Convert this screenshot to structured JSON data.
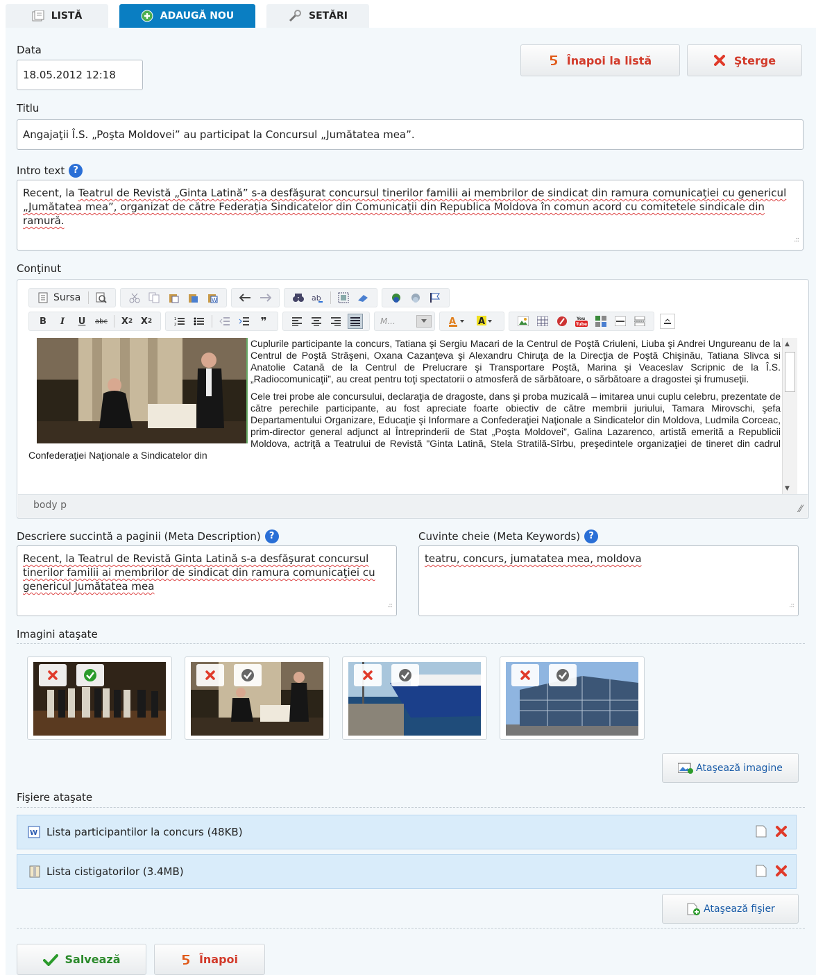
{
  "tabs": [
    {
      "label": "LISTĂ"
    },
    {
      "label": "ADAUGĂ NOU"
    },
    {
      "label": "SETĂRI"
    }
  ],
  "form": {
    "date_label": "Data",
    "date_value": "18.05.2012 12:18",
    "back_to_list": "Înapoi la listă",
    "delete": "Şterge",
    "title_label": "Titlu",
    "title_value": "Angajaţii Î.S. „Poşta Moldovei” au participat la Concursul „Jumătatea mea”.",
    "intro_label": "Intro text",
    "intro_value_1": "Recent,  la ",
    "intro_words": [
      "Teatrul de Revistă „Ginta Latină” s-a desfăşurat  concursul tinerilor familii ai membrilor de sindicat din ramura comunicaţiei cu genericul „Jumătatea mea”, organizat de către Federaţia Sindicatelor din Comunicaţii din Republica Moldova în comun acord cu comitetele sindicale din ramură."
    ],
    "content_label": "Conţinut",
    "meta_description_label": "Descriere succintă a paginii (Meta Description)",
    "meta_description_value": "Recent,  la Teatrul de Revistă Ginta Latină s-a desfăşurat concursul tinerilor familii ai membrilor de sindicat din ramura comunicaţiei cu genericul Jumătatea mea",
    "meta_keywords_label": "Cuvinte cheie (Meta Keywords)",
    "meta_keywords_value": "teatru, concurs, jumatatea mea, moldova",
    "images_label": "Imagini ataşate",
    "attach_image": "Ataşează imagine",
    "files_label": "Fişiere ataşate",
    "files": [
      {
        "name": "Lista participantilor la concurs (48KB)"
      },
      {
        "name": "Lista cistigatorilor (3.4MB)"
      }
    ],
    "attach_file": "Ataşează fişier",
    "save": "Salvează",
    "back": "Înapoi",
    "help_glyph": "?"
  },
  "editor": {
    "source_label": "Sursa",
    "font_placeholder": "M...",
    "path": "body  p",
    "paragraph_1": "Cuplurile participante la concurs, Tatiana şi Sergiu Macari de la Centrul de Poştă Criuleni, Liuba şi Andrei Ungureanu de la Centrul de Poştă Străşeni, Oxana Cazanţeva şi Alexandru Chiruţa de la Direcţia de Poştă Chişinău, Tatiana Slivca si Anatolie Catană de la Centrul de Prelucrare şi Transportare Poştă, Marina şi Veaceslav Scripnic de la Î.S. „Radiocomunicaţii”, au creat pentru toţi spectatorii o atmosferă de sărbătoare, o sărbătoare a dragostei şi frumuseţii.",
    "paragraph_2": "Cele trei probe ale concursului, declaraţia de dragoste, dans şi proba muzicală – imitarea unui cuplu celebru, prezentate de către perechile participante, au fost apreciate foarte obiectiv de către membrii juriului, Tamara Mirovschi, şefa Departamentului Organizare, Educaţie şi Informare a Confederaţiei Naţionale a Sindicatelor din Moldova, Ludmila Corceac, prim-director general adjunct al Întreprinderii de Stat „Poşta Moldovei”, Galina Lazarenco, artistă emerită a Republicii Moldova, actriţă a Teatrului de Revistă \"Ginta Latină, Stela Stratilă-Sîrbu, preşedintele organizaţiei de tineret din cadrul Confederaţiei Naţionale  a Sindicatelor din"
  },
  "colors": {
    "accent": "#0a7ec2",
    "danger": "#d23a2a",
    "success": "#2b9b2b",
    "panel": "#f3f8fb"
  }
}
